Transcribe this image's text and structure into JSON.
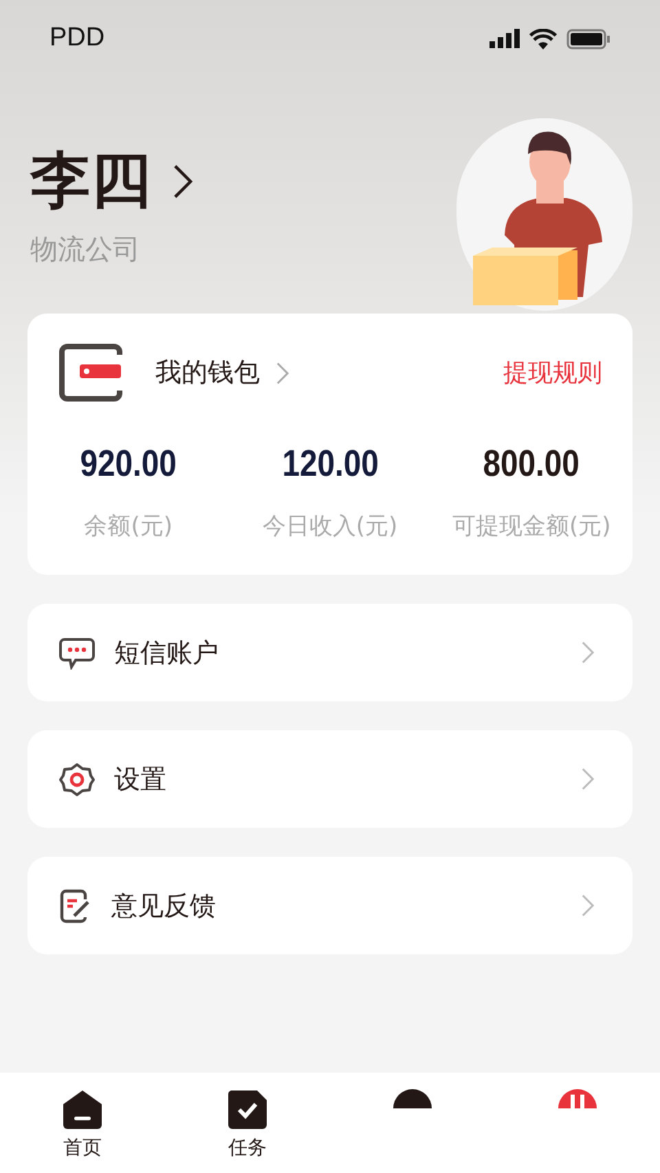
{
  "status_bar": {
    "carrier": "PDD"
  },
  "profile": {
    "name": "李四",
    "company": "物流公司"
  },
  "wallet": {
    "title": "我的钱包",
    "link": "提现规则",
    "stats": [
      {
        "value": "920.00",
        "label": "余额(元)",
        "color": "#141a3a"
      },
      {
        "value": "120.00",
        "label": "今日收入(元)",
        "color": "#141a3a"
      },
      {
        "value": "800.00",
        "label": "可提现金额(元)",
        "color": "#231815"
      }
    ]
  },
  "menu": [
    {
      "kind": "sms",
      "label": "短信账户"
    },
    {
      "kind": "settings",
      "label": "设置"
    },
    {
      "kind": "feedback",
      "label": "意见反馈"
    }
  ],
  "tab_bar": [
    {
      "kind": "home",
      "label": "首页",
      "selected": false
    },
    {
      "kind": "tasks",
      "label": "任务",
      "selected": false
    },
    {
      "kind": "dark",
      "selected": false
    },
    {
      "kind": "mine",
      "selected": true
    }
  ]
}
